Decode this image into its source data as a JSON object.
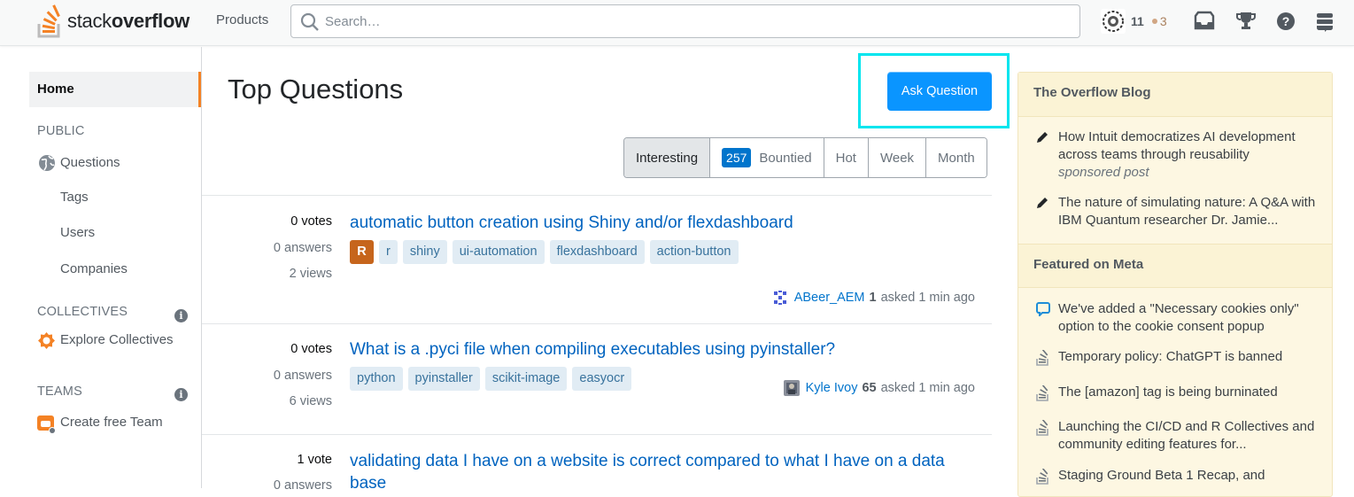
{
  "header": {
    "logo_light": "stack",
    "logo_bold": "overflow",
    "products_label": "Products",
    "search_placeholder": "Search…",
    "reputation": "11",
    "bronze_badges": "3"
  },
  "leftnav": {
    "home_label": "Home",
    "public_label": "PUBLIC",
    "questions_label": "Questions",
    "tags_label": "Tags",
    "users_label": "Users",
    "companies_label": "Companies",
    "collectives_label": "COLLECTIVES",
    "explore_collectives_label": "Explore Collectives",
    "teams_label": "TEAMS",
    "create_team_label": "Create free Team"
  },
  "main": {
    "title": "Top Questions",
    "ask_button": "Ask Question",
    "filters": {
      "interesting": "Interesting",
      "bounty_count": "257",
      "bountied": "Bountied",
      "hot": "Hot",
      "week": "Week",
      "month": "Month"
    },
    "questions": [
      {
        "votes": "0 votes",
        "answers": "0 answers",
        "views": "2 views",
        "title": "automatic button creation using Shiny and/or flexdashboard",
        "tag_r_badge": "R",
        "tags": [
          "r",
          "shiny",
          "ui-automation",
          "flexdashboard",
          "action-button"
        ],
        "user": "ABeer_AEM",
        "user_rep": "1",
        "asked": "asked 1 min ago"
      },
      {
        "votes": "0 votes",
        "answers": "0 answers",
        "views": "6 views",
        "title": "What is a .pyci file when compiling executables using pyinstaller?",
        "tags": [
          "python",
          "pyinstaller",
          "scikit-image",
          "easyocr"
        ],
        "user": "Kyle Ivoy",
        "user_rep": "65",
        "asked": "asked 1 min ago"
      },
      {
        "votes": "1 vote",
        "answers": "0 answers",
        "title": "validating data I have on a website is correct compared to what I have on a data base"
      }
    ]
  },
  "sidebar": {
    "blog_header": "The Overflow Blog",
    "blog_items": [
      {
        "text": "How Intuit democratizes AI development across teams through reusability",
        "sub": "sponsored post"
      },
      {
        "text": "The nature of simulating nature: A Q&A with IBM Quantum researcher Dr. Jamie..."
      }
    ],
    "meta_header": "Featured on Meta",
    "meta_items": [
      "We've added a \"Necessary cookies only\" option to the cookie consent popup",
      "Temporary policy: ChatGPT is banned",
      "The [amazon] tag is being burninated",
      "Launching the CI/CD and R Collectives and community editing features for...",
      "Staging Ground Beta 1 Recap, and"
    ]
  },
  "colors": {
    "brand_orange": "#f48225",
    "ask_button_blue": "#0a95ff",
    "link_blue": "#0063bf",
    "highlight_cyan": "#00e5ee",
    "tag_bg": "#e1ecf4"
  }
}
